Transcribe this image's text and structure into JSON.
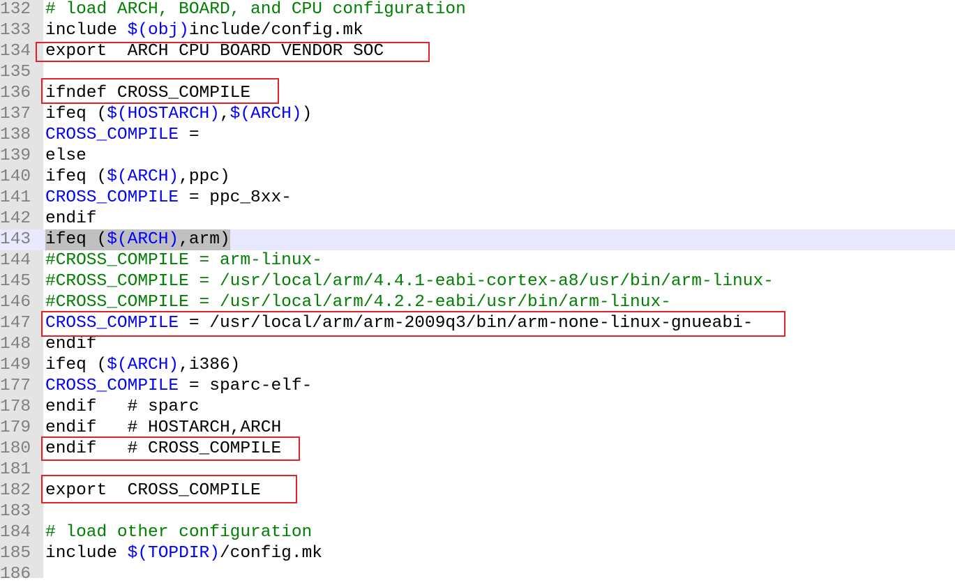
{
  "colors": {
    "default": "#000000",
    "comment": "#008000",
    "variable": "#0000ff",
    "line_number": "#808080",
    "gutter": "#e4e4e4",
    "current_line": "#e8e8ff",
    "selection": "#c0c0c0",
    "annotation_box": "#e5202a"
  },
  "lines": [
    {
      "n": "132",
      "segs": [
        {
          "t": "# load ARCH, BOARD, and CPU configuration",
          "c": "comment"
        }
      ]
    },
    {
      "n": "133",
      "segs": [
        {
          "t": "include ",
          "c": "default"
        },
        {
          "t": "$(obj)",
          "c": "variable"
        },
        {
          "t": "include/config.mk",
          "c": "default"
        }
      ]
    },
    {
      "n": "134",
      "segs": [
        {
          "t": "export  ARCH CPU BOARD VENDOR SOC",
          "c": "default"
        }
      ]
    },
    {
      "n": "135",
      "segs": []
    },
    {
      "n": "136",
      "segs": [
        {
          "t": "ifndef CROSS_COMPILE",
          "c": "default"
        }
      ]
    },
    {
      "n": "137",
      "segs": [
        {
          "t": "ifeq (",
          "c": "default"
        },
        {
          "t": "$(HOSTARCH)",
          "c": "variable"
        },
        {
          "t": ",",
          "c": "default"
        },
        {
          "t": "$(ARCH)",
          "c": "variable"
        },
        {
          "t": ")",
          "c": "default"
        }
      ]
    },
    {
      "n": "138",
      "segs": [
        {
          "t": "CROSS_COMPILE",
          "c": "variable"
        },
        {
          "t": " =",
          "c": "default"
        }
      ]
    },
    {
      "n": "139",
      "segs": [
        {
          "t": "else",
          "c": "default"
        }
      ]
    },
    {
      "n": "140",
      "segs": [
        {
          "t": "ifeq (",
          "c": "default"
        },
        {
          "t": "$(ARCH)",
          "c": "variable"
        },
        {
          "t": ",ppc)",
          "c": "default"
        }
      ]
    },
    {
      "n": "141",
      "segs": [
        {
          "t": "CROSS_COMPILE",
          "c": "variable"
        },
        {
          "t": " = ppc_8xx-",
          "c": "default"
        }
      ]
    },
    {
      "n": "142",
      "segs": [
        {
          "t": "endif",
          "c": "default"
        }
      ]
    },
    {
      "n": "143",
      "current": true,
      "selected": true,
      "segs": [
        {
          "t": "ifeq (",
          "c": "default"
        },
        {
          "t": "$(ARCH)",
          "c": "variable"
        },
        {
          "t": ",arm)",
          "c": "default"
        }
      ]
    },
    {
      "n": "144",
      "segs": [
        {
          "t": "#CROSS_COMPILE = arm-linux-",
          "c": "comment"
        }
      ]
    },
    {
      "n": "145",
      "segs": [
        {
          "t": "#CROSS_COMPILE = /usr/local/arm/4.4.1-eabi-cortex-a8/usr/bin/arm-linux-",
          "c": "comment"
        }
      ]
    },
    {
      "n": "146",
      "segs": [
        {
          "t": "#CROSS_COMPILE = /usr/local/arm/4.2.2-eabi/usr/bin/arm-linux-",
          "c": "comment"
        }
      ]
    },
    {
      "n": "147",
      "segs": [
        {
          "t": "CROSS_COMPILE",
          "c": "variable"
        },
        {
          "t": " = /usr/local/arm/arm-2009q3/bin/arm-none-linux-gnueabi-",
          "c": "default"
        }
      ]
    },
    {
      "n": "148",
      "segs": [
        {
          "t": "endif",
          "c": "default"
        }
      ]
    },
    {
      "n": "149",
      "segs": [
        {
          "t": "ifeq (",
          "c": "default"
        },
        {
          "t": "$(ARCH)",
          "c": "variable"
        },
        {
          "t": ",i386)",
          "c": "default"
        }
      ]
    },
    {
      "n": "177",
      "segs": [
        {
          "t": "CROSS_COMPILE",
          "c": "variable"
        },
        {
          "t": " = sparc-elf-",
          "c": "default"
        }
      ]
    },
    {
      "n": "178",
      "segs": [
        {
          "t": "endif   # sparc",
          "c": "default"
        }
      ]
    },
    {
      "n": "179",
      "segs": [
        {
          "t": "endif   # HOSTARCH,ARCH",
          "c": "default"
        }
      ]
    },
    {
      "n": "180",
      "segs": [
        {
          "t": "endif   # CROSS_COMPILE",
          "c": "default"
        }
      ]
    },
    {
      "n": "181",
      "segs": []
    },
    {
      "n": "182",
      "segs": [
        {
          "t": "export  CROSS_COMPILE",
          "c": "default"
        }
      ]
    },
    {
      "n": "183",
      "segs": []
    },
    {
      "n": "184",
      "segs": [
        {
          "t": "# load other configuration",
          "c": "comment"
        }
      ]
    },
    {
      "n": "185",
      "segs": [
        {
          "t": "include ",
          "c": "default"
        },
        {
          "t": "$(TOPDIR)",
          "c": "variable"
        },
        {
          "t": "/config.mk",
          "c": "default"
        }
      ]
    },
    {
      "n": "186",
      "segs": []
    }
  ]
}
